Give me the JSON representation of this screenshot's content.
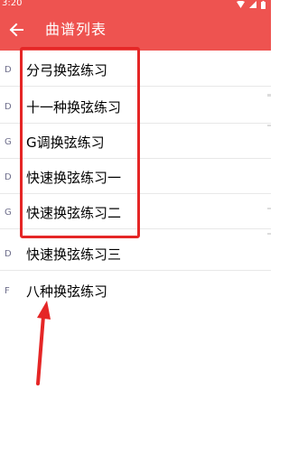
{
  "status_bar": {
    "time": "3:20",
    "icons": [
      "wifi-icon",
      "signal-icon",
      "battery-icon"
    ]
  },
  "app_bar": {
    "back_icon": "arrow-left-icon",
    "title": "曲谱列表"
  },
  "songs": [
    {
      "key": "D",
      "title": "分弓换弦练习"
    },
    {
      "key": "D",
      "title": "十一种换弦练习"
    },
    {
      "key": "G",
      "title": "G调换弦练习"
    },
    {
      "key": "D",
      "title": "快速换弦练习一"
    },
    {
      "key": "G",
      "title": "快速换弦练习二"
    },
    {
      "key": "D",
      "title": "快速换弦练习三"
    },
    {
      "key": "F",
      "title": "八种换弦练习"
    }
  ],
  "colors": {
    "app_bar": "#ee5350",
    "annotation": "#e52626"
  }
}
